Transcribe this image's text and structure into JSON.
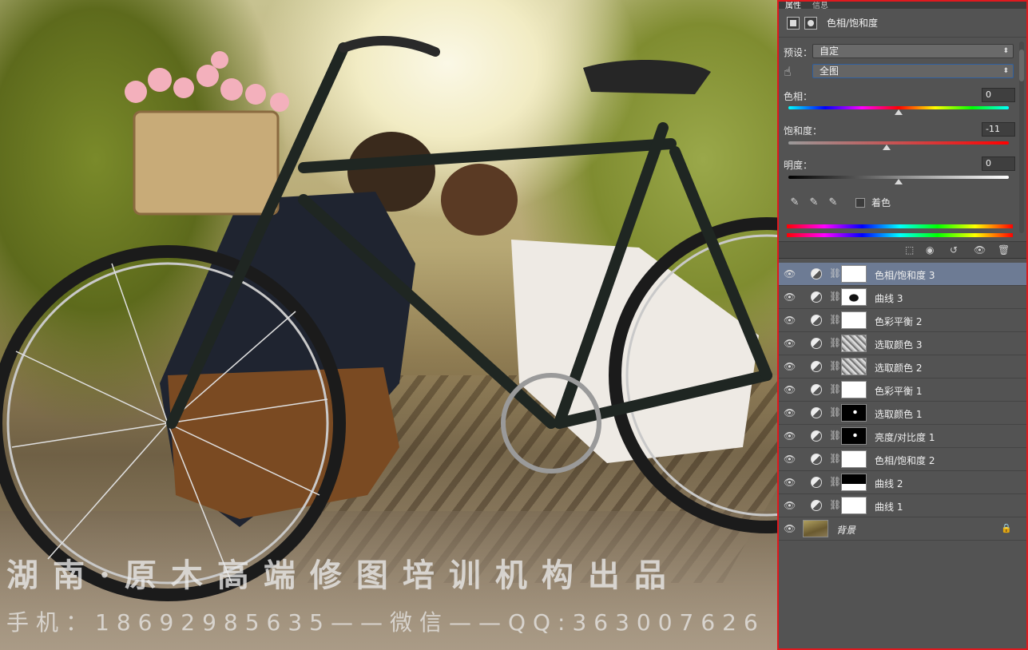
{
  "canvas": {
    "watermark_line1": "湖南·原木高端修图培训机构出品",
    "watermark_line2": "手机：18692985635——微信——QQ:363007626"
  },
  "properties_panel": {
    "tabs": [
      "属性",
      "信息"
    ],
    "title": "色相/饱和度",
    "preset_label": "预设：",
    "preset_value": "自定",
    "range_value": "全图",
    "hue_label": "色相：",
    "hue_value": "0",
    "saturation_label": "饱和度：",
    "saturation_value": "-11",
    "lightness_label": "明度：",
    "lightness_value": "0",
    "colorize_label": "着色",
    "slider_positions": {
      "hue": 0.5,
      "saturation": 0.445,
      "lightness": 0.5
    }
  },
  "layers": [
    {
      "name": "色相/饱和度 3",
      "mask": "white",
      "selected": true
    },
    {
      "name": "曲线 3",
      "mask": "blob",
      "selected": false
    },
    {
      "name": "色彩平衡 2",
      "mask": "white",
      "selected": false
    },
    {
      "name": "选取颜色 3",
      "mask": "noise",
      "selected": false
    },
    {
      "name": "选取颜色 2",
      "mask": "noise",
      "selected": false
    },
    {
      "name": "色彩平衡 1",
      "mask": "white",
      "selected": false
    },
    {
      "name": "选取颜色 1",
      "mask": "spot",
      "selected": false
    },
    {
      "name": "亮度/对比度 1",
      "mask": "spot",
      "selected": false
    },
    {
      "name": "色相/饱和度 2",
      "mask": "white",
      "selected": false
    },
    {
      "name": "曲线 2",
      "mask": "curve2",
      "selected": false
    },
    {
      "name": "曲线 1",
      "mask": "white",
      "selected": false
    }
  ],
  "background_layer": {
    "name": "背景"
  },
  "colors": {
    "panel_bg": "#535353",
    "selected_layer": "#6d7b94",
    "highlight_border": "#e0191e"
  }
}
